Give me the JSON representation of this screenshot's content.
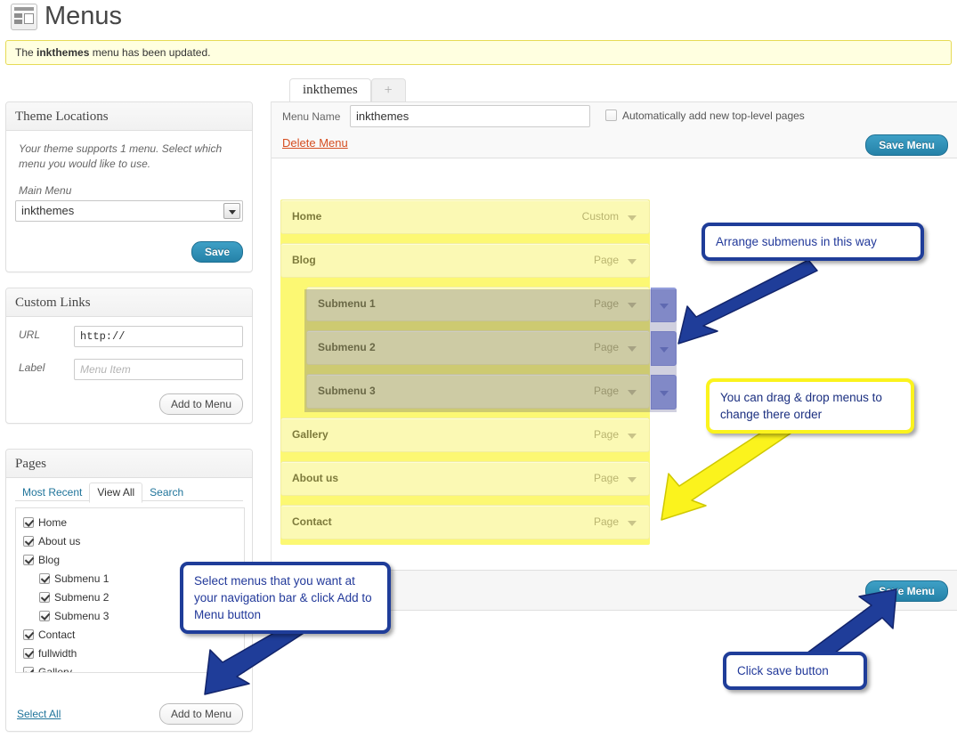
{
  "header": {
    "title": "Menus",
    "icon": "menus-icon"
  },
  "notice": {
    "prefix": "The ",
    "menu_name": "inkthemes",
    "suffix": " menu has been updated."
  },
  "theme_locations": {
    "panel_title": "Theme Locations",
    "description": "Your theme supports 1 menu. Select which menu you would like to use.",
    "select_label": "Main Menu",
    "selected_value": "inkthemes",
    "save_label": "Save"
  },
  "custom_links": {
    "panel_title": "Custom Links",
    "url_label": "URL",
    "url_value": "http://",
    "label_label": "Label",
    "label_placeholder": "Menu Item",
    "add_label": "Add to Menu"
  },
  "pages": {
    "panel_title": "Pages",
    "tabs": [
      {
        "label": "Most Recent",
        "active": false
      },
      {
        "label": "View All",
        "active": true
      },
      {
        "label": "Search",
        "active": false
      }
    ],
    "items": [
      {
        "label": "Home",
        "checked": true,
        "child": false
      },
      {
        "label": "About us",
        "checked": true,
        "child": false
      },
      {
        "label": "Blog",
        "checked": true,
        "child": false
      },
      {
        "label": "Submenu 1",
        "checked": true,
        "child": true
      },
      {
        "label": "Submenu 2",
        "checked": true,
        "child": true
      },
      {
        "label": "Submenu 3",
        "checked": true,
        "child": true
      },
      {
        "label": "Contact",
        "checked": true,
        "child": false
      },
      {
        "label": "fullwidth",
        "checked": true,
        "child": false
      },
      {
        "label": "Gallery",
        "checked": true,
        "child": false
      }
    ],
    "select_all_label": "Select All",
    "add_label": "Add to Menu"
  },
  "menu_editor": {
    "tabs": [
      {
        "label": "inkthemes",
        "active": true
      },
      {
        "label": "+",
        "active": false
      }
    ],
    "menu_name_label": "Menu Name",
    "menu_name_value": "inkthemes",
    "auto_add_label": "Automatically add new top-level pages",
    "auto_add_checked": false,
    "delete_label": "Delete Menu",
    "save_label_top": "Save Menu",
    "save_label_bottom": "Save Menu",
    "items": [
      {
        "title": "Home",
        "type": "Custom",
        "depth": 0
      },
      {
        "title": "Blog",
        "type": "Page",
        "depth": 0
      },
      {
        "title": "Submenu 1",
        "type": "Page",
        "depth": 1
      },
      {
        "title": "Submenu 2",
        "type": "Page",
        "depth": 1
      },
      {
        "title": "Submenu 3",
        "type": "Page",
        "depth": 1
      },
      {
        "title": "Gallery",
        "type": "Page",
        "depth": 0
      },
      {
        "title": "About us",
        "type": "Page",
        "depth": 0
      },
      {
        "title": "Contact",
        "type": "Page",
        "depth": 0
      }
    ]
  },
  "callouts": {
    "arrange": "Arrange submenus in this way",
    "drag": "You can drag & drop menus to change there order",
    "select": "Select menus that you want at your navigation bar & click Add to Menu button",
    "click_save": "Click save button"
  },
  "colors": {
    "callout_blue": "#1f3d99",
    "callout_yellow": "#fbf31d",
    "callout_text": "#22399a",
    "menu_row_yellow": "#fbf9b4",
    "menu_area_yellow": "#fcf873",
    "button_blue": "#2582a8",
    "delete_red": "#d54e21",
    "link_blue": "#21759b",
    "notice_bg": "#ffffe0",
    "notice_border": "#e6db55",
    "drag_handle_blue": "#9aa5e0"
  }
}
